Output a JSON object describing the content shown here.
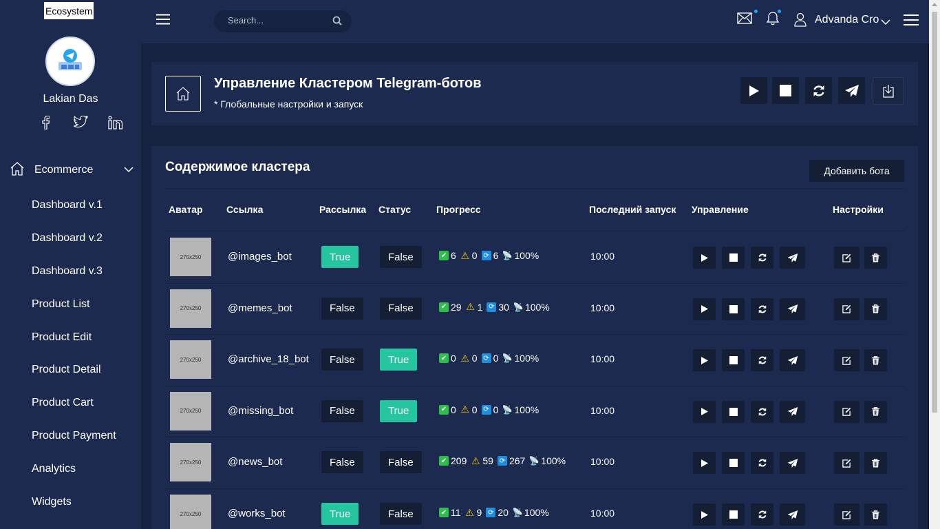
{
  "brand": "Ecosystem",
  "user": {
    "name": "Lakian Das"
  },
  "socials": [
    {
      "icon": "facebook-icon",
      "label": "f"
    },
    {
      "icon": "twitter-icon",
      "label": "twitter"
    },
    {
      "icon": "linkedin-icon",
      "label": "in"
    }
  ],
  "sidebar": {
    "section_label": "Ecommerce",
    "items": [
      {
        "label": "Dashboard v.1"
      },
      {
        "label": "Dashboard v.2"
      },
      {
        "label": "Dashboard v.3"
      },
      {
        "label": "Product List"
      },
      {
        "label": "Product Edit"
      },
      {
        "label": "Product Detail"
      },
      {
        "label": "Product Cart"
      },
      {
        "label": "Product Payment"
      },
      {
        "label": "Analytics"
      },
      {
        "label": "Widgets"
      }
    ]
  },
  "topbar": {
    "search_placeholder": "Search...",
    "user_name": "Advanda Cro"
  },
  "header": {
    "title": "Управление Кластером Telegram-ботов",
    "subtitle": "* Глобальные настройки и запуск"
  },
  "table": {
    "title": "Содержимое кластера",
    "add_button": "Добавить бота",
    "columns": [
      "Аватар",
      "Ссылка",
      "Рассылка",
      "Статус",
      "Прогресс",
      "Последний запуск",
      "Управление",
      "Настройки"
    ],
    "rows": [
      {
        "thumb": "270x250",
        "link": "@images_bot",
        "mailing": "True",
        "status": "False",
        "ok": "6",
        "warn": "0",
        "sync": "6",
        "pct": "100%",
        "last_run": "10:00"
      },
      {
        "thumb": "270x250",
        "link": "@memes_bot",
        "mailing": "False",
        "status": "False",
        "ok": "29",
        "warn": "1",
        "sync": "30",
        "pct": "100%",
        "last_run": "10:00"
      },
      {
        "thumb": "270x250",
        "link": "@archive_18_bot",
        "mailing": "False",
        "status": "True",
        "ok": "0",
        "warn": "0",
        "sync": "0",
        "pct": "100%",
        "last_run": "10:00"
      },
      {
        "thumb": "270x250",
        "link": "@missing_bot",
        "mailing": "False",
        "status": "True",
        "ok": "0",
        "warn": "0",
        "sync": "0",
        "pct": "100%",
        "last_run": "10:00"
      },
      {
        "thumb": "270x250",
        "link": "@news_bot",
        "mailing": "False",
        "status": "False",
        "ok": "209",
        "warn": "59",
        "sync": "267",
        "pct": "100%",
        "last_run": "10:00"
      },
      {
        "thumb": "270x250",
        "link": "@works_bot",
        "mailing": "True",
        "status": "False",
        "ok": "11",
        "warn": "9",
        "sync": "20",
        "pct": "100%",
        "last_run": "10:00"
      }
    ]
  },
  "colors": {
    "background": "#152240",
    "panel": "#1b2a4e",
    "button": "#141f36",
    "true_badge": "#25c5a0",
    "notification_dot": "#1ea7ff"
  }
}
